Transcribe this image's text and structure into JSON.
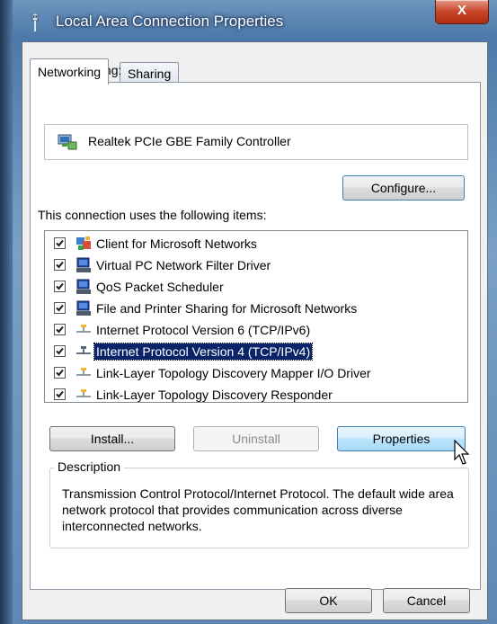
{
  "window": {
    "title": "Local Area Connection Properties",
    "close_label": "X"
  },
  "tabs": [
    {
      "label": "Networking",
      "active": true
    },
    {
      "label": "Sharing",
      "active": false
    }
  ],
  "connect_using": {
    "label": "Connect using:",
    "adapter_name": "Realtek PCIe GBE Family Controller",
    "adapter_icon": "network-adapter-icon",
    "configure_label": "Configure..."
  },
  "items": {
    "label": "This connection uses the following items:",
    "list": [
      {
        "label": "Client for Microsoft Networks",
        "checked": true,
        "icon": "client-icon"
      },
      {
        "label": "Virtual PC Network Filter Driver",
        "checked": true,
        "icon": "service-icon"
      },
      {
        "label": "QoS Packet Scheduler",
        "checked": true,
        "icon": "service-icon"
      },
      {
        "label": "File and Printer Sharing for Microsoft Networks",
        "checked": true,
        "icon": "service-icon"
      },
      {
        "label": "Internet Protocol Version 6 (TCP/IPv6)",
        "checked": true,
        "icon": "protocol-icon"
      },
      {
        "label": "Internet Protocol Version 4 (TCP/IPv4)",
        "checked": true,
        "icon": "protocol-icon",
        "selected": true
      },
      {
        "label": "Link-Layer Topology Discovery Mapper I/O Driver",
        "checked": true,
        "icon": "protocol-icon"
      },
      {
        "label": "Link-Layer Topology Discovery Responder",
        "checked": true,
        "icon": "protocol-icon"
      }
    ]
  },
  "buttons": {
    "install": "Install...",
    "uninstall": "Uninstall",
    "properties": "Properties",
    "ok": "OK",
    "cancel": "Cancel"
  },
  "description": {
    "title": "Description",
    "text": "Transmission Control Protocol/Internet Protocol. The default wide area network protocol that provides communication across diverse interconnected networks."
  },
  "colors": {
    "selection": "#0a246a",
    "title_bar": "#5f88b4",
    "close_button": "#c8452a"
  }
}
